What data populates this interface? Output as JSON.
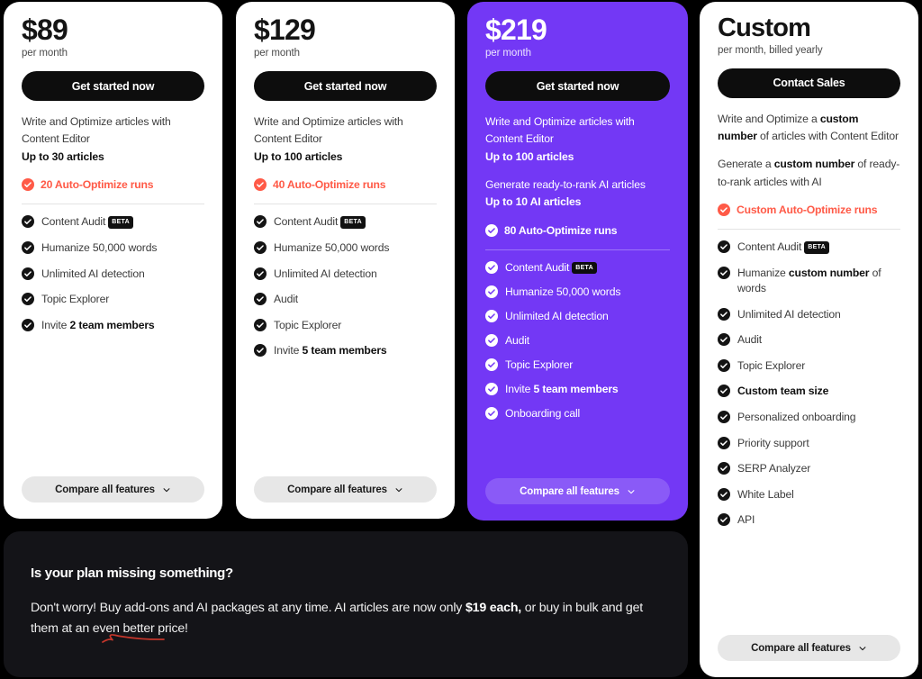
{
  "colors": {
    "page_background": "#000000",
    "card_light": "#ffffff",
    "card_highlight_purple": "#7338F5",
    "accent_coral": "#FF5A47",
    "cta_black": "#0D0D0D",
    "promo_background": "#141418"
  },
  "plans": [
    {
      "id": "starter",
      "price": "$89",
      "period": "per month",
      "cta_label": "Get started now",
      "blocks": [
        {
          "lines": [
            "Write and Optimize articles with",
            "Content Editor"
          ],
          "bold_line": "Up to 30 articles"
        }
      ],
      "accent": {
        "icon": "check-circle-icon",
        "label": "20 Auto-Optimize runs"
      },
      "features": [
        {
          "label": "Content Audit",
          "badge": "BETA"
        },
        {
          "label": "Humanize 50,000 words"
        },
        {
          "label": "Unlimited AI detection"
        },
        {
          "label": "Topic Explorer"
        },
        {
          "label_prefix": "Invite ",
          "label_bold": "2 team members"
        }
      ],
      "compare_label": "Compare all features"
    },
    {
      "id": "growth",
      "price": "$129",
      "period": "per month",
      "cta_label": "Get started now",
      "blocks": [
        {
          "lines": [
            "Write and Optimize articles with",
            "Content Editor"
          ],
          "bold_line": "Up to 100 articles"
        }
      ],
      "accent": {
        "icon": "check-circle-icon",
        "label": "40 Auto-Optimize runs"
      },
      "features": [
        {
          "label": "Content Audit",
          "badge": "BETA"
        },
        {
          "label": "Humanize 50,000 words"
        },
        {
          "label": "Unlimited AI detection"
        },
        {
          "label": "Audit"
        },
        {
          "label": "Topic Explorer"
        },
        {
          "label_prefix": "Invite ",
          "label_bold": "5 team members"
        }
      ],
      "compare_label": "Compare all features"
    },
    {
      "id": "pro",
      "price": "$219",
      "period": "per month",
      "cta_label": "Get started now",
      "blocks": [
        {
          "lines": [
            "Write and Optimize articles with",
            "Content Editor"
          ],
          "bold_line": "Up to 100 articles"
        },
        {
          "lines": [
            "Generate ready-to-rank AI articles"
          ],
          "bold_line": "Up to 10 AI articles"
        }
      ],
      "accent": {
        "icon": "check-circle-icon",
        "label": "80 Auto-Optimize runs"
      },
      "features": [
        {
          "label": "Content Audit",
          "badge": "BETA"
        },
        {
          "label": "Humanize 50,000 words"
        },
        {
          "label": "Unlimited AI detection"
        },
        {
          "label": "Audit"
        },
        {
          "label": "Topic Explorer"
        },
        {
          "label_prefix": "Invite ",
          "label_bold": "5 team members"
        },
        {
          "label": "Onboarding call"
        }
      ],
      "compare_label": "Compare all features"
    },
    {
      "id": "custom",
      "price": "Custom",
      "period": "per month, billed yearly",
      "cta_label": "Contact Sales",
      "blocks": [
        {
          "rich": "Write and Optimize a <b>custom number</b> of articles with Content Editor"
        },
        {
          "rich": "Generate a <b>custom number</b> of ready-to-rank articles with AI"
        }
      ],
      "accent": {
        "icon": "check-circle-icon",
        "label": "Custom Auto-Optimize runs"
      },
      "features": [
        {
          "label": "Content Audit",
          "badge": "BETA"
        },
        {
          "label_prefix": "Humanize ",
          "label_bold": "custom number",
          "label_suffix": " of words"
        },
        {
          "label": "Unlimited AI detection"
        },
        {
          "label": "Audit"
        },
        {
          "label": "Topic Explorer"
        },
        {
          "label": "Custom team size",
          "strong": true
        },
        {
          "label": "Personalized onboarding"
        },
        {
          "label": "Priority support"
        },
        {
          "label": "SERP Analyzer"
        },
        {
          "label": "White Label"
        },
        {
          "label": "API"
        }
      ],
      "compare_label": "Compare all features"
    }
  ],
  "promo": {
    "title": "Is your plan missing something?",
    "body_prefix": "Don't worry! Buy add-ons and AI packages at any time. AI articles are now only ",
    "body_bold": "$19 each,",
    "body_suffix": " or buy in bulk and get them at an even better price!"
  }
}
